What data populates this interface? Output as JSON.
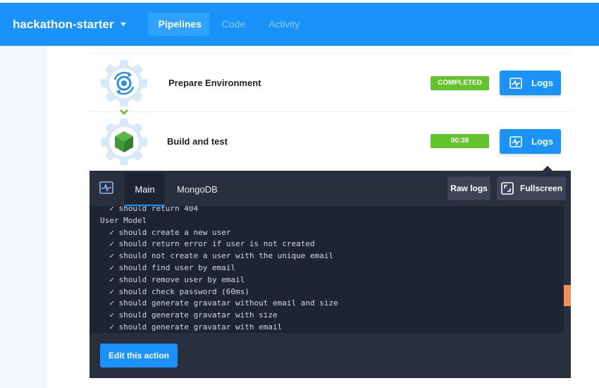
{
  "topnav": {
    "project": "hackathon-starter",
    "tabs": [
      {
        "label": "Pipelines"
      },
      {
        "label": "Code"
      },
      {
        "label": "Activity"
      }
    ]
  },
  "stages": [
    {
      "title": "Prepare Environment",
      "status": "COMPLETED",
      "logs_label": "Logs",
      "icon": "sync-gear-icon"
    },
    {
      "title": "Build and test",
      "status": "00:38",
      "logs_label": "Logs",
      "icon": "nodejs-hexagon-icon"
    }
  ],
  "console": {
    "tabs": [
      {
        "label": "Main"
      },
      {
        "label": "MongoDB"
      }
    ],
    "raw_logs_label": "Raw logs",
    "fullscreen_label": "Fullscreen",
    "log_lines": [
      "  ✓ should return 404",
      "User Model",
      "  ✓ should create a new user",
      "  ✓ should return error if user is not created",
      "  ✓ should not create a user with the unique email",
      "  ✓ should find user by email",
      "  ✓ should remove user by email",
      "  ✓ should check password (60ms)",
      "  ✓ should generate gravatar without email and size",
      "  ✓ should generate gravatar with size",
      "  ✓ should generate gravatar with email"
    ],
    "edit_action_label": "Edit this action"
  },
  "colors": {
    "brand_blue": "#1993fa",
    "success_green": "#62c42a",
    "console_bg": "#2a2f40",
    "log_bg": "#1f2433"
  }
}
